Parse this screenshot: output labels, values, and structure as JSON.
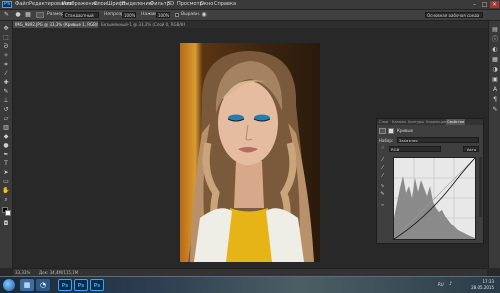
{
  "app": {
    "logo": "Ps"
  },
  "menu": [
    "Файл",
    "Редактирование",
    "Изображение",
    "Слои",
    "Шрифт",
    "Выделение",
    "Фильтр",
    "3D",
    "Просмотр",
    "Окно",
    "Справка"
  ],
  "window_controls": {
    "minimize": "–",
    "maximize": "□",
    "close": "✕"
  },
  "options_bar": {
    "size_label": "Размер:",
    "size_value": "Стандартный",
    "opacity_label": "Непрозр.:",
    "opacity_value": "100%",
    "flow_label": "Нажим:",
    "flow_value": "100%",
    "align_label": "Выравн.",
    "workspace": "Основная рабочая среда"
  },
  "tabs": [
    {
      "label": "IMG_9892.JPG @ 33,3% (Кривые 1, RGB/8*) *",
      "active": true
    },
    {
      "label": "Безымянный-1 @ 33,3% (Слой 0, RGB/8#) *",
      "active": false
    }
  ],
  "status": {
    "zoom": "33,33%",
    "doc": "Док: 34,4M/115,1M"
  },
  "panel": {
    "tabs": [
      "Слои",
      "Каналы",
      "Контуры",
      "Коррекция",
      "Свойства"
    ],
    "active_tab": "Свойства",
    "title": "Кривые",
    "preset_label": "Набор:",
    "preset_value": "Заказная",
    "channel_value": "RGB",
    "auto_label": "Авто"
  },
  "taskbar": {
    "apps": [
      "Ps",
      "Ps",
      "Ps"
    ],
    "lang": "RU",
    "time": "17:33",
    "date": "28.05.2015"
  },
  "colors": {
    "accent": "#31a8ff",
    "ui_bg": "#282828",
    "panel_bg": "#3f3f3f"
  }
}
